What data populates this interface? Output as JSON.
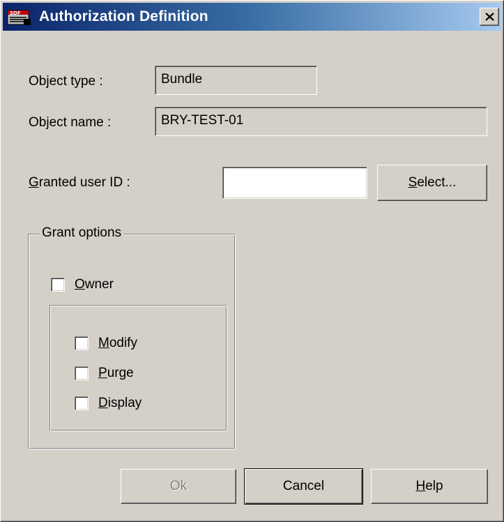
{
  "window": {
    "title": "Authorization Definition",
    "close_symbol": "×",
    "icon": "app-icon"
  },
  "form": {
    "object_type_label": "Object type :",
    "object_type_value": "Bundle",
    "object_name_label": "Object name :",
    "object_name_value": "BRY-TEST-01",
    "granted_user_label": "Granted user ID :",
    "granted_user_mnemonic": "G",
    "granted_user_label_rest": "ranted user ID :",
    "granted_user_value": "",
    "select_button_mnemonic": "S",
    "select_button_rest": "elect..."
  },
  "grant_options": {
    "legend": "Grant options",
    "owner": {
      "mnemonic": "O",
      "rest": "wner",
      "checked": false
    },
    "sub_options": [
      {
        "mnemonic": "M",
        "rest": "odify",
        "checked": false
      },
      {
        "mnemonic": "P",
        "rest": "urge",
        "checked": false
      },
      {
        "mnemonic": "D",
        "rest": "isplay",
        "checked": false
      }
    ]
  },
  "buttons": {
    "ok_label": "Ok",
    "ok_enabled": false,
    "cancel_label": "Cancel",
    "help_mnemonic": "H",
    "help_rest": "elp"
  },
  "colors": {
    "title_start": "#0a246a",
    "title_end": "#a6caf0",
    "face": "#d4d0c8"
  }
}
